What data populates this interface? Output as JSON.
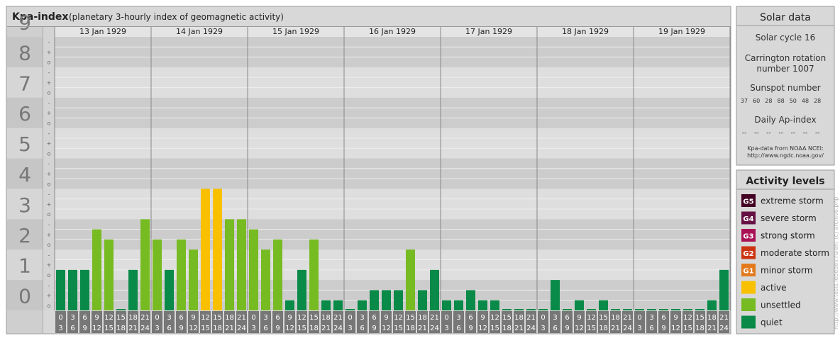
{
  "chart_panel": {
    "title": "Kpa-index",
    "subtitle": "(planetary 3-hourly index of geomagnetic activity)"
  },
  "chart_data": {
    "type": "bar",
    "ylim": [
      0,
      9
    ],
    "y_major_labels": [
      "0",
      "1",
      "2",
      "3",
      "4",
      "5",
      "6",
      "7",
      "8",
      "9"
    ],
    "y_minor_labels": [
      "o",
      "+",
      "-"
    ],
    "days": [
      "13 Jan 1929",
      "14 Jan 1929",
      "15 Jan 1929",
      "16 Jan 1929",
      "17 Jan 1929",
      "18 Jan 1929",
      "19 Jan 1929"
    ],
    "interval_labels": [
      [
        "0",
        "3"
      ],
      [
        "3",
        "6"
      ],
      [
        "6",
        "9"
      ],
      [
        "9",
        "12"
      ],
      [
        "12",
        "15"
      ],
      [
        "15",
        "18"
      ],
      [
        "18",
        "21"
      ],
      [
        "21",
        "24"
      ]
    ],
    "values": [
      1.333,
      1.333,
      1.333,
      2.667,
      2.333,
      0.0,
      1.333,
      3.0,
      2.333,
      1.333,
      2.333,
      2.0,
      4.0,
      4.0,
      3.0,
      3.0,
      2.667,
      2.0,
      2.333,
      0.333,
      1.333,
      2.333,
      0.333,
      0.333,
      0.0,
      0.333,
      0.667,
      0.667,
      0.667,
      2.0,
      0.667,
      1.333,
      0.333,
      0.333,
      0.667,
      0.333,
      0.333,
      0.0,
      0.0,
      0.0,
      0.0,
      1.0,
      0.0,
      0.333,
      0.0,
      0.333,
      0.0,
      0.0,
      0.0,
      0.0,
      0.0,
      0.0,
      0.0,
      0.0,
      0.333,
      1.333
    ],
    "colors": {
      "quiet": "#0a8a48",
      "unsettled": "#77bb22",
      "active": "#f9c000",
      "g1": "#e27a1d",
      "g2": "#cc3311",
      "g3": "#aa1155",
      "g4": "#661144",
      "g5": "#440022"
    }
  },
  "solar_data": {
    "title": "Solar data",
    "solar_cycle": "Solar cycle 16",
    "carrington_line1": "Carrington rotation",
    "carrington_line2": "number 1007",
    "sunspot_title": "Sunspot number",
    "sunspot_values": [
      "37",
      "60",
      "28",
      "88",
      "50",
      "48",
      "28"
    ],
    "ap_title": "Daily Ap-index",
    "ap_values": [
      "--",
      "--",
      "--",
      "--",
      "--",
      "--",
      "--"
    ],
    "source_line1": "Kpa-data from NOAA NCEI:",
    "source_line2": "http://www.ngdc.noaa.gov/"
  },
  "activity_levels": {
    "title": "Activity levels",
    "items": [
      {
        "badge": "G5",
        "label": "extreme storm",
        "color": "#440022"
      },
      {
        "badge": "G4",
        "label": "severe storm",
        "color": "#661144"
      },
      {
        "badge": "G3",
        "label": "strong storm",
        "color": "#aa1155"
      },
      {
        "badge": "G2",
        "label": "moderate storm",
        "color": "#cc3311"
      },
      {
        "badge": "G1",
        "label": "minor storm",
        "color": "#e27a1d"
      },
      {
        "badge": "",
        "label": "active",
        "color": "#f9c000"
      },
      {
        "badge": "",
        "label": "unsettled",
        "color": "#77bb22"
      },
      {
        "badge": "",
        "label": "quiet",
        "color": "#0a8a48"
      }
    ]
  },
  "credit": "http://www.tesis.lebedev.ru/en/  (c) archive.php"
}
